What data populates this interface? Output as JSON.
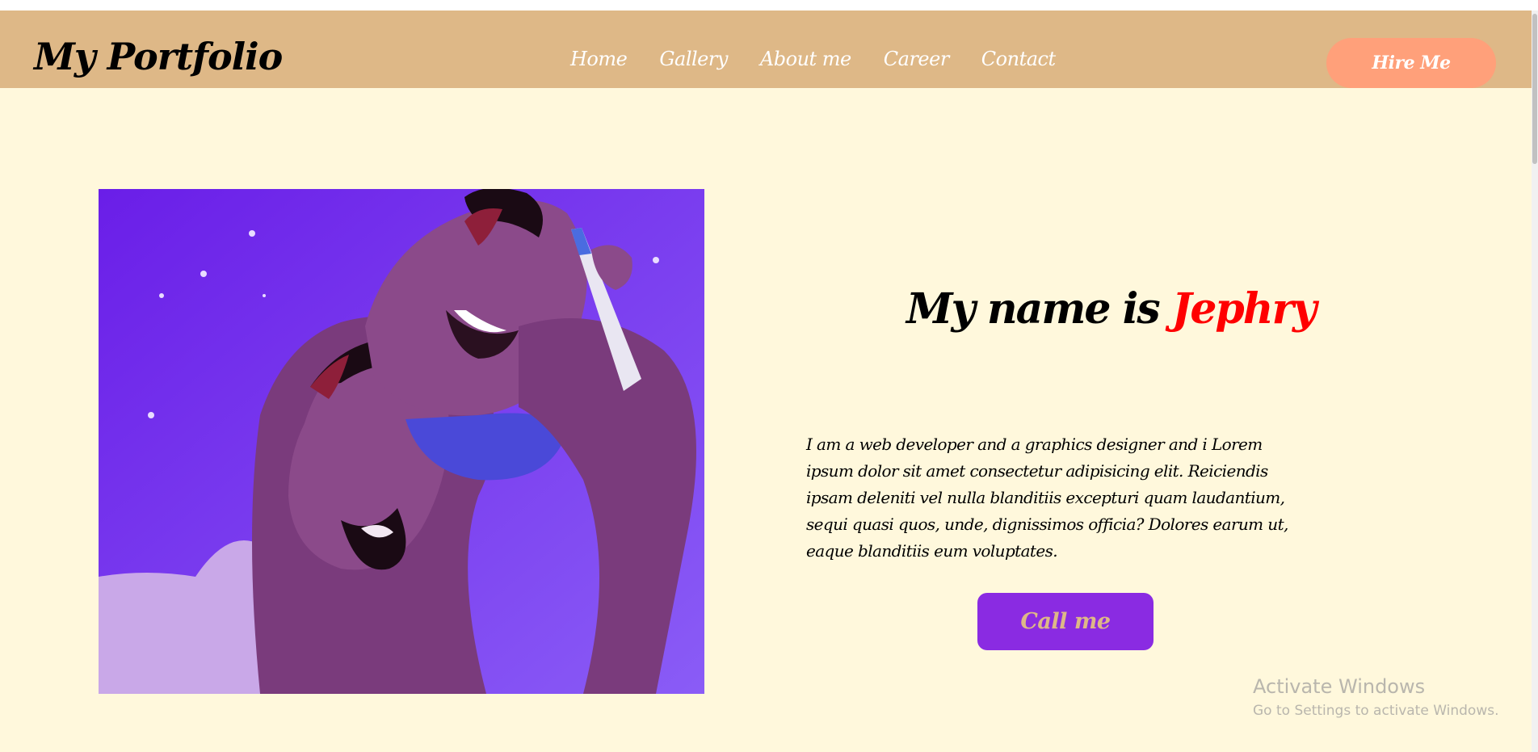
{
  "header": {
    "logo": "My Portfolio",
    "nav": [
      {
        "label": "Home"
      },
      {
        "label": "Gallery"
      },
      {
        "label": "About me"
      },
      {
        "label": "Career"
      },
      {
        "label": "Contact"
      }
    ],
    "hire_label": "Hire Me"
  },
  "hero": {
    "heading_prefix": "My name is",
    "heading_name": "Jephry",
    "bio": "I am a web developer and a graphics designer and i Lorem ipsum dolor sit amet consectetur adipisicing elit. Reiciendis ipsam deleniti vel nulla blanditiis excepturi quam laudantium, sequi quasi quos, unde, dignissimos officia? Dolores earum ut, eaque blanditiis eum voluptates.",
    "call_label": "Call me"
  },
  "watermark": {
    "title": "Activate Windows",
    "subtitle": "Go to Settings to activate Windows."
  },
  "colors": {
    "page_bg": "#fff8dc",
    "navbar_bg": "#deb887",
    "hire_btn": "#ffa07a",
    "call_btn": "#8a2be2",
    "name_accent": "#ff0000"
  }
}
